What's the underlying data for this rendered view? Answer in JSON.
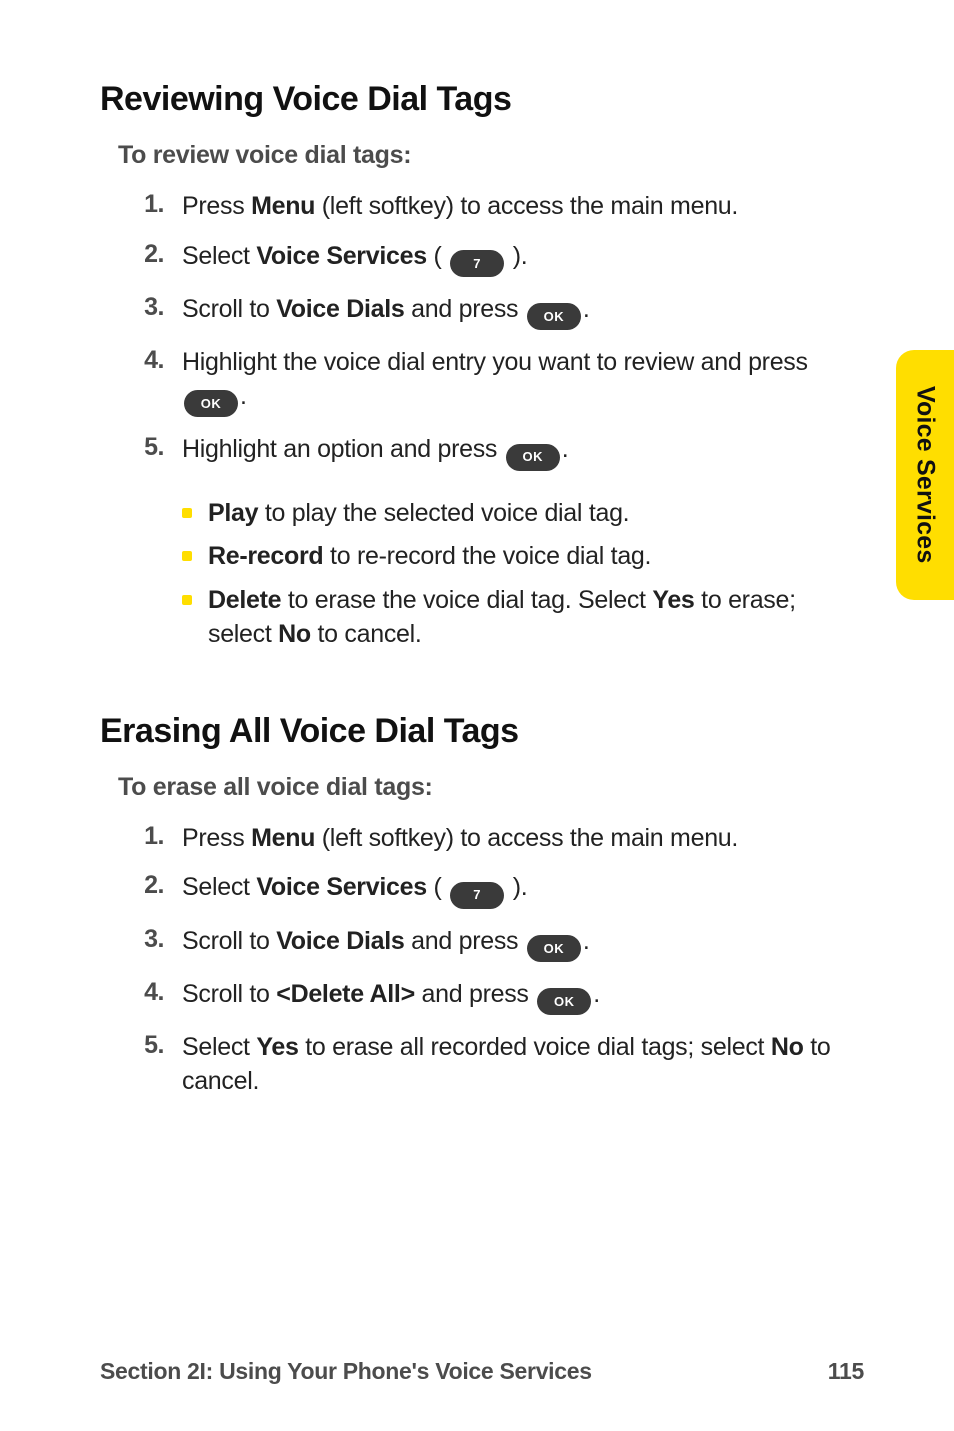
{
  "sideTab": "Voice Services",
  "sections": [
    {
      "heading": "Reviewing Voice Dial Tags",
      "sub": "To review voice dial tags:",
      "steps": [
        {
          "num": "1.",
          "parts": [
            {
              "t": "Press "
            },
            {
              "t": "Menu",
              "b": true
            },
            {
              "t": " (left softkey) to access the main menu."
            }
          ]
        },
        {
          "num": "2.",
          "parts": [
            {
              "t": "Select "
            },
            {
              "t": "Voice Services",
              "b": true
            },
            {
              "t": " ( "
            },
            {
              "key": "7"
            },
            {
              "t": " )."
            }
          ]
        },
        {
          "num": "3.",
          "parts": [
            {
              "t": "Scroll to "
            },
            {
              "t": "Voice Dials",
              "b": true
            },
            {
              "t": " and press "
            },
            {
              "key": "OK"
            },
            {
              "t": "."
            }
          ]
        },
        {
          "num": "4.",
          "parts": [
            {
              "t": "Highlight the voice dial entry you want to review and press "
            },
            {
              "key": "OK"
            },
            {
              "t": "."
            }
          ]
        },
        {
          "num": "5.",
          "parts": [
            {
              "t": "Highlight an option and press "
            },
            {
              "key": "OK"
            },
            {
              "t": "."
            }
          ],
          "bullets": [
            [
              {
                "t": "Play",
                "b": true
              },
              {
                "t": " to play the selected voice dial tag."
              }
            ],
            [
              {
                "t": "Re-record",
                "b": true
              },
              {
                "t": " to re-record the voice dial tag."
              }
            ],
            [
              {
                "t": "Delete",
                "b": true
              },
              {
                "t": " to erase the voice dial tag. Select "
              },
              {
                "t": "Yes",
                "b": true
              },
              {
                "t": " to erase; select "
              },
              {
                "t": "No",
                "b": true
              },
              {
                "t": " to cancel."
              }
            ]
          ]
        }
      ]
    },
    {
      "heading": "Erasing All Voice Dial Tags",
      "sub": "To erase all voice dial tags:",
      "steps": [
        {
          "num": "1.",
          "parts": [
            {
              "t": "Press "
            },
            {
              "t": "Menu",
              "b": true
            },
            {
              "t": " (left softkey) to access the main menu."
            }
          ]
        },
        {
          "num": "2.",
          "parts": [
            {
              "t": "Select "
            },
            {
              "t": "Voice Services",
              "b": true
            },
            {
              "t": " ( "
            },
            {
              "key": "7"
            },
            {
              "t": " )."
            }
          ]
        },
        {
          "num": "3.",
          "parts": [
            {
              "t": "Scroll to "
            },
            {
              "t": "Voice Dials",
              "b": true
            },
            {
              "t": " and press "
            },
            {
              "key": "OK"
            },
            {
              "t": "."
            }
          ]
        },
        {
          "num": "4.",
          "parts": [
            {
              "t": "Scroll to "
            },
            {
              "t": "<Delete All>",
              "b": true
            },
            {
              "t": " and press "
            },
            {
              "key": "OK"
            },
            {
              "t": "."
            }
          ]
        },
        {
          "num": "5.",
          "parts": [
            {
              "t": "Select "
            },
            {
              "t": "Yes",
              "b": true
            },
            {
              "t": " to erase all recorded voice dial tags; select "
            },
            {
              "t": "No",
              "b": true
            },
            {
              "t": " to cancel."
            }
          ]
        }
      ]
    }
  ],
  "footer": {
    "left": "Section 2I: Using Your Phone's Voice Services",
    "right": "115"
  }
}
